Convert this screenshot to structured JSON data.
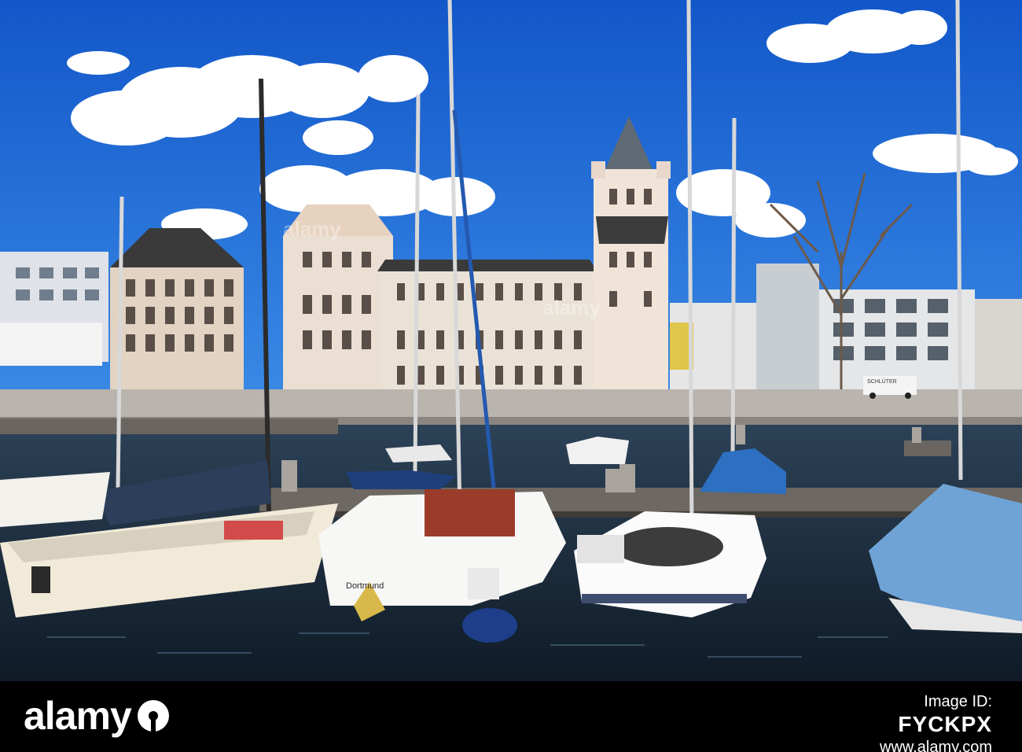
{
  "photo": {
    "watermark": "alamy",
    "boat_hull_text": "Dortmund",
    "van_text": "SCHLÜTER",
    "colors": {
      "sky": "#1f6fd6",
      "water": "#1b2a3a",
      "facade": "#e8ddd0",
      "sail_cover": "#3c7fc0"
    }
  },
  "footer": {
    "brand": "alamy",
    "image_id_label": "Image ID:",
    "image_id": "FYCKPX",
    "website": "www.alamy.com"
  }
}
